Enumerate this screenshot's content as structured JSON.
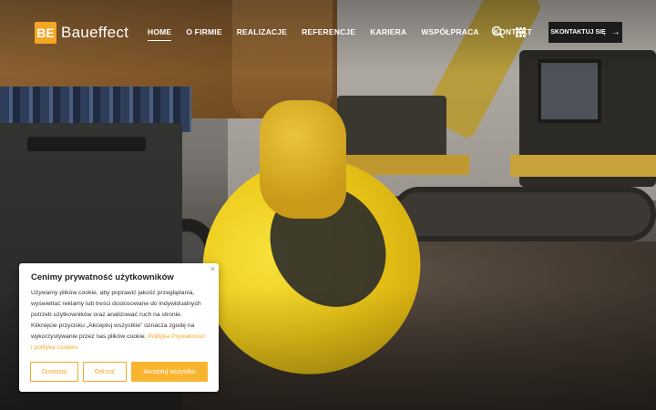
{
  "header": {
    "logo_mark": "BE",
    "logo_text": "Baueffect",
    "nav": [
      "HOME",
      "O FIRMIE",
      "REALIZACJE",
      "REFERENCJE",
      "KARIERA",
      "WSPÓŁPRACA",
      "KONTAKT"
    ],
    "active_nav": "HOME",
    "contact_label": "SKONTAKTUJ SIĘ",
    "contact_arrow": "→"
  },
  "cookie": {
    "title": "Cenimy prywatność użytkowników",
    "text": "Używamy plików cookie, aby poprawić jakość przeglądania, wyświetlać reklamy lub treści dostosowane do indywidualnych potrzeb użytkowników oraz analizować ruch na stronie. Kliknięcie przycisku „Akceptuj wszystkie” oznacza zgodę na wykorzystywanie przez nas plików cookie.",
    "link_text": "Polityka Prywatności i polityka cookies",
    "close": "×",
    "btn_customize": "Dostosuj",
    "btn_reject": "Odrzuć",
    "btn_accept": "Akceptuj wszystko"
  },
  "colors": {
    "accent": "#f5a623",
    "dark_button": "#1c1c1d",
    "text": "#333333"
  },
  "icons": {
    "search": "search-icon",
    "menu": "grid-menu-icon",
    "logo": "logo-icon"
  }
}
